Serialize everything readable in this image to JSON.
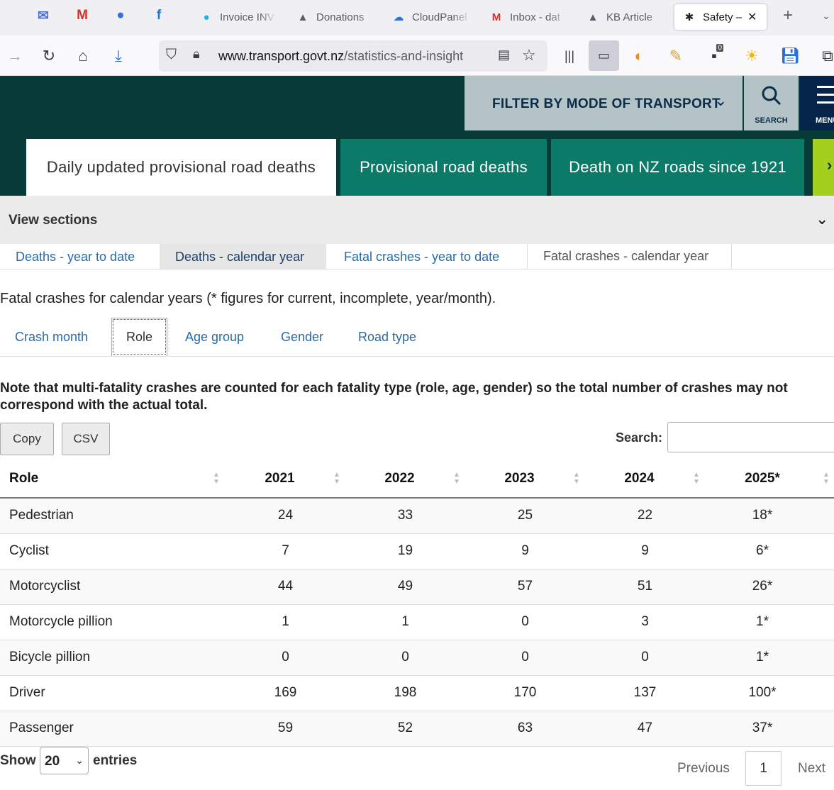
{
  "browser": {
    "tabs": [
      {
        "label": "Invoice INV",
        "icon": "xero-icon"
      },
      {
        "label": "Donations",
        "icon": "hat-icon"
      },
      {
        "label": "CloudPanel",
        "icon": "cloud-icon"
      },
      {
        "label": "Inbox - dat",
        "icon": "gmail-icon"
      },
      {
        "label": "KB Article",
        "icon": "hat-icon"
      },
      {
        "label": "Safety –",
        "icon": "snowflake-icon"
      }
    ],
    "url_domain": "www.transport.govt.nz",
    "url_path": "/statistics-and-insight",
    "extension_badge": "0"
  },
  "header": {
    "filter_label": "FILTER BY MODE OF TRANSPORT",
    "search_label": "SEARCH",
    "menu_label": "MENU"
  },
  "content_tabs": [
    "Daily updated provisional road deaths",
    "Provisional road deaths",
    "Death on NZ roads since 1921"
  ],
  "view_sections": "View sections",
  "section_tabs": [
    "Deaths - year to date",
    "Deaths - calendar year",
    "Fatal crashes - year to date",
    "Fatal crashes - calendar year"
  ],
  "heading": "Fatal crashes for calendar years (* figures for current, incomplete, year/month).",
  "subtabs": [
    "Crash month",
    "Role",
    "Age group",
    "Gender",
    "Road type"
  ],
  "note": "Note that multi-fatality crashes are counted for each fatality type (role, age, gender) so the total number of crashes may not correspond with the actual total.",
  "buttons": {
    "copy": "Copy",
    "csv": "CSV"
  },
  "search_label": "Search:",
  "table": {
    "headers": [
      "Role",
      "2021",
      "2022",
      "2023",
      "2024",
      "2025*"
    ],
    "rows": [
      [
        "Pedestrian",
        "24",
        "33",
        "25",
        "22",
        "18*"
      ],
      [
        "Cyclist",
        "7",
        "19",
        "9",
        "9",
        "6*"
      ],
      [
        "Motorcyclist",
        "44",
        "49",
        "57",
        "51",
        "26*"
      ],
      [
        "Motorcycle pillion",
        "1",
        "1",
        "0",
        "3",
        "1*"
      ],
      [
        "Bicycle pillion",
        "0",
        "0",
        "0",
        "0",
        "1*"
      ],
      [
        "Driver",
        "169",
        "198",
        "170",
        "137",
        "100*"
      ],
      [
        "Passenger",
        "59",
        "52",
        "63",
        "47",
        "37*"
      ]
    ]
  },
  "pagination": {
    "show": "Show",
    "entries_value": "20",
    "entries": "entries",
    "previous": "Previous",
    "page": "1",
    "next": "Next"
  }
}
